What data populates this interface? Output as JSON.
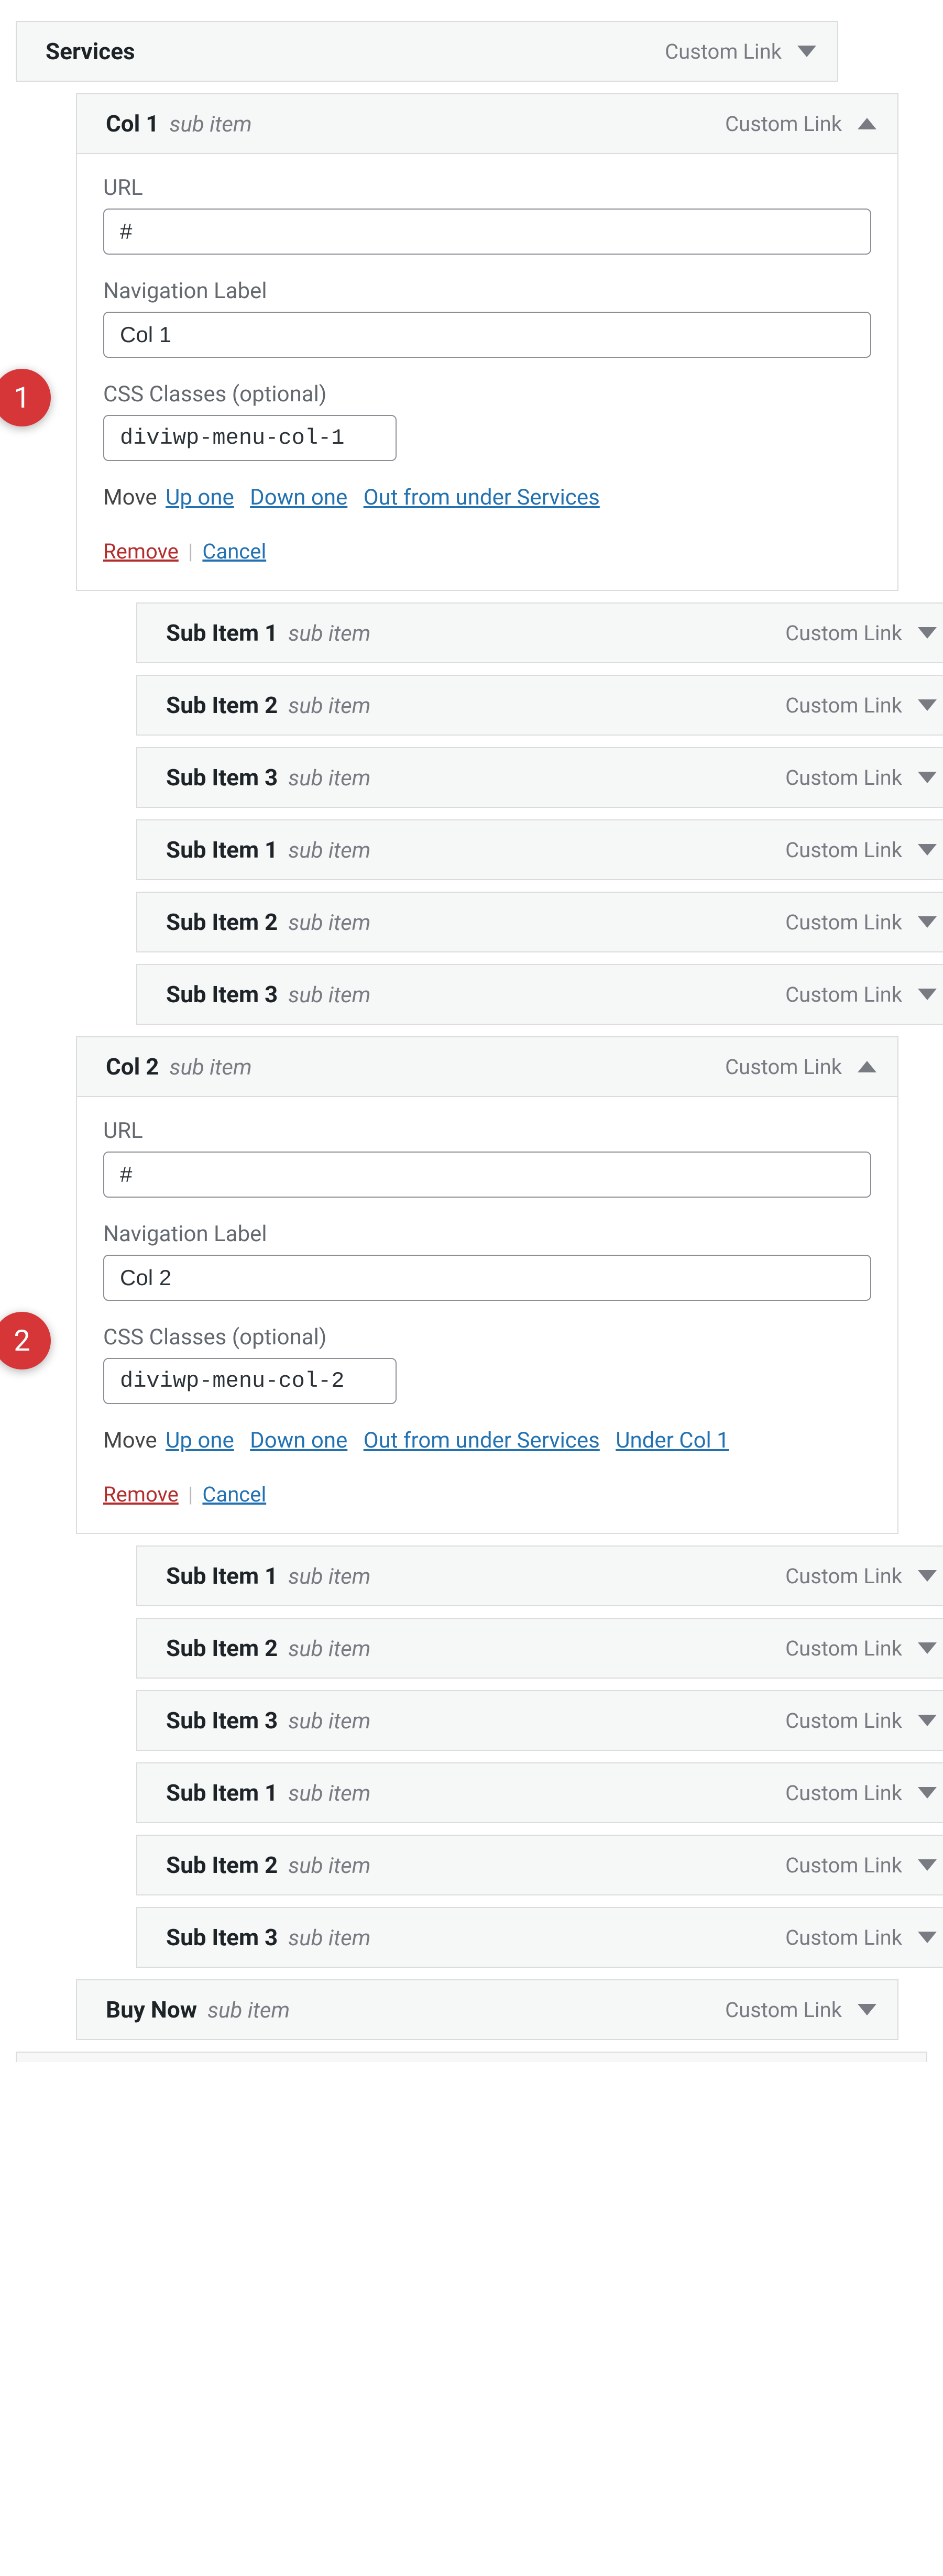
{
  "strings": {
    "custom_link": "Custom Link",
    "sub_item": "sub item",
    "url_label": "URL",
    "nav_label": "Navigation Label",
    "css_label": "CSS Classes (optional)",
    "move": "Move",
    "up_one": "Up one",
    "down_one": "Down one",
    "out_services": "Out from under Services",
    "under_col1": "Under Col 1",
    "remove": "Remove",
    "cancel": "Cancel"
  },
  "annotations": {
    "a1": "1",
    "a2": "2"
  },
  "top": {
    "title": "Services"
  },
  "col1": {
    "title": "Col 1",
    "url": "#",
    "nav": "Col 1",
    "css": "diviwp-menu-col-1"
  },
  "col1_subs": [
    {
      "title": "Sub Item 1"
    },
    {
      "title": "Sub Item 2"
    },
    {
      "title": "Sub Item 3"
    },
    {
      "title": "Sub Item 1"
    },
    {
      "title": "Sub Item 2"
    },
    {
      "title": "Sub Item 3"
    }
  ],
  "col2": {
    "title": "Col 2",
    "url": "#",
    "nav": "Col 2",
    "css": "diviwp-menu-col-2"
  },
  "col2_subs": [
    {
      "title": "Sub Item 1"
    },
    {
      "title": "Sub Item 2"
    },
    {
      "title": "Sub Item 3"
    },
    {
      "title": "Sub Item 1"
    },
    {
      "title": "Sub Item 2"
    },
    {
      "title": "Sub Item 3"
    }
  ],
  "buy": {
    "title": "Buy Now"
  }
}
